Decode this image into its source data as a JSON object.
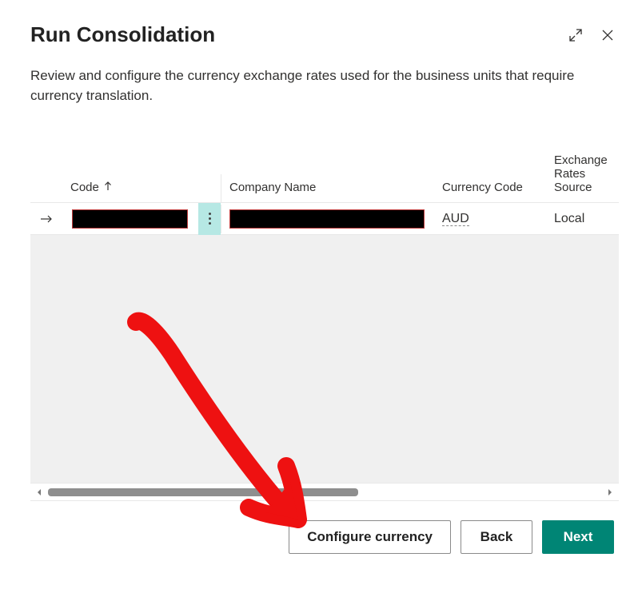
{
  "dialog": {
    "title": "Run Consolidation",
    "description": "Review and configure the currency exchange rates used for the business units that require currency translation."
  },
  "table": {
    "headers": {
      "code": "Code",
      "company_name": "Company Name",
      "currency_code": "Currency Code",
      "exchange_rates_source": "Exchange Rates Source"
    },
    "row": {
      "code_redacted": true,
      "company_name_redacted": true,
      "currency_code": "AUD",
      "exchange_rates_source": "Local"
    }
  },
  "footer": {
    "configure_currency": "Configure currency",
    "back": "Back",
    "next": "Next"
  }
}
